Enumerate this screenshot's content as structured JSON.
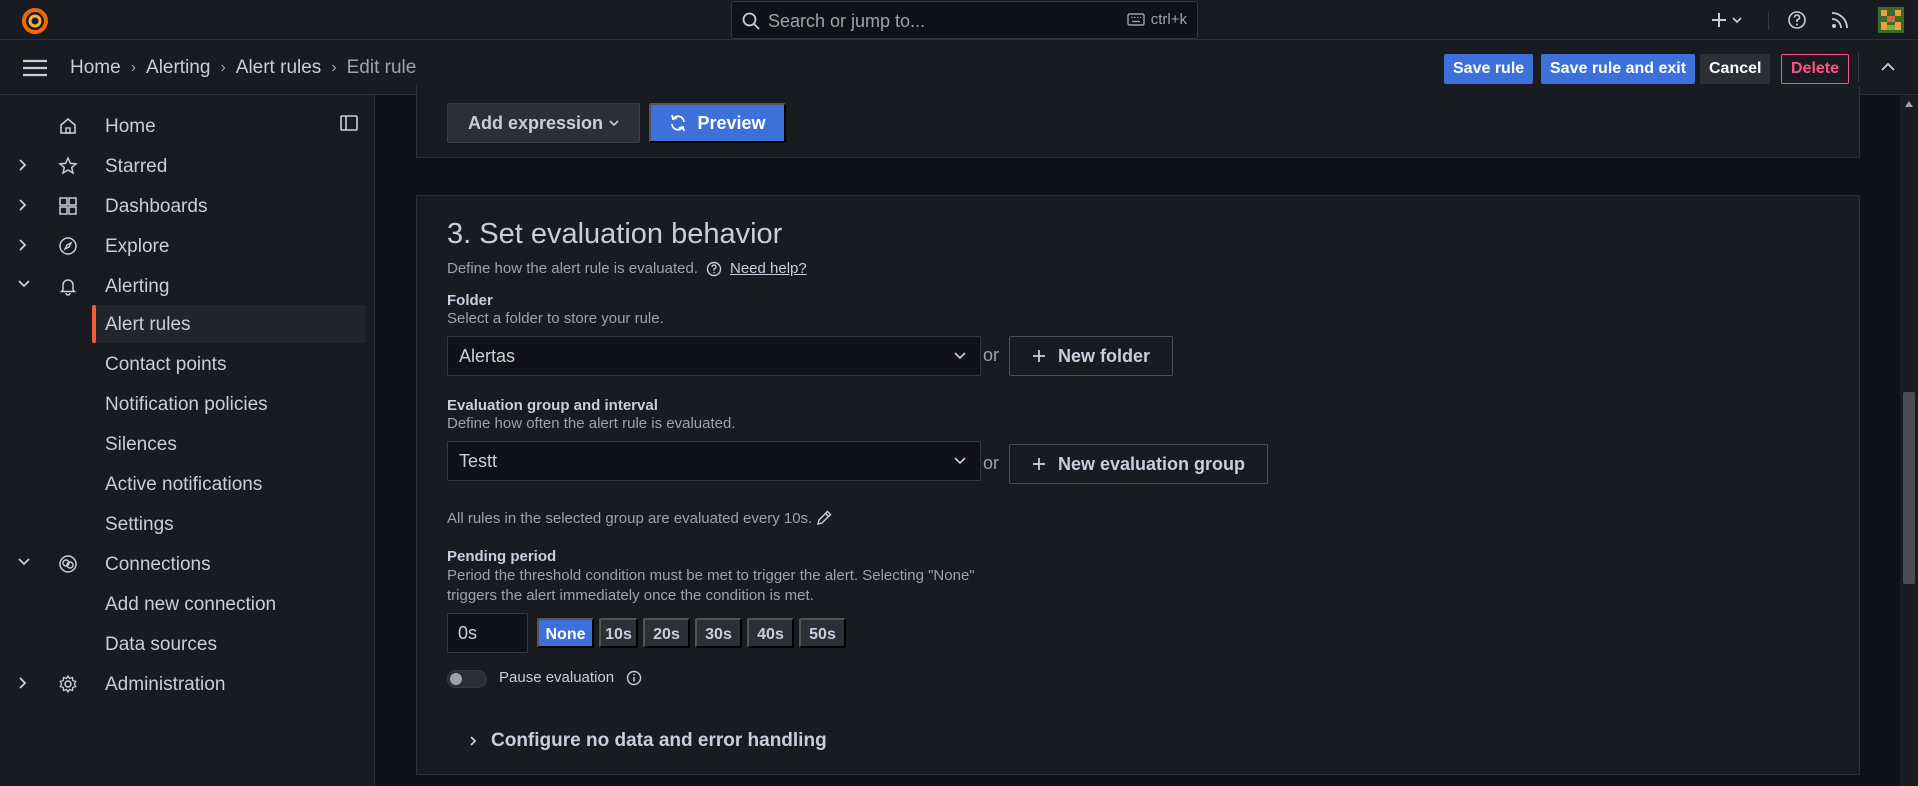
{
  "topbar": {
    "search_placeholder": "Search or jump to...",
    "shortcut": "ctrl+k",
    "icons": [
      "grafana-logo-icon",
      "search-icon",
      "keyboard-icon",
      "plus-icon",
      "chevron-down-icon",
      "help-icon",
      "rss-icon",
      "avatar"
    ]
  },
  "breadcrumb": {
    "items": [
      "Home",
      "Alerting",
      "Alert rules",
      "Edit rule"
    ],
    "separator": "›"
  },
  "actions": {
    "save": "Save rule",
    "save_exit": "Save rule and exit",
    "cancel": "Cancel",
    "delete": "Delete"
  },
  "sidebar": {
    "items": [
      {
        "label": "Home",
        "icon": "home-icon"
      },
      {
        "label": "Starred",
        "icon": "star-icon"
      },
      {
        "label": "Dashboards",
        "icon": "dashboards-icon"
      },
      {
        "label": "Explore",
        "icon": "compass-icon"
      },
      {
        "label": "Alerting",
        "icon": "bell-icon"
      },
      {
        "label": "Connections",
        "icon": "connections-icon"
      },
      {
        "label": "Administration",
        "icon": "gear-icon"
      }
    ],
    "alerting_children": [
      "Alert rules",
      "Contact points",
      "Notification policies",
      "Silences",
      "Active notifications",
      "Settings"
    ],
    "connections_children": [
      "Add new connection",
      "Data sources"
    ]
  },
  "query_section": {
    "add_expression": "Add expression",
    "preview": "Preview"
  },
  "evaluation": {
    "title": "3. Set evaluation behavior",
    "description": "Define how the alert rule is evaluated.",
    "help_link": "Need help?",
    "folder": {
      "label": "Folder",
      "description": "Select a folder to store your rule.",
      "value": "Alertas",
      "or": "or",
      "new_button": "New folder"
    },
    "group": {
      "label": "Evaluation group and interval",
      "description": "Define how often the alert rule is evaluated.",
      "value": "Testt",
      "or": "or",
      "new_button": "New evaluation group"
    },
    "group_info": "All rules in the selected group are evaluated every 10s.",
    "pending": {
      "label": "Pending period",
      "description_line1": "Period the threshold condition must be met to trigger the alert. Selecting \"None\"",
      "description_line2": "triggers the alert immediately once the condition is met.",
      "value": "0s",
      "options": [
        "None",
        "10s",
        "20s",
        "30s",
        "40s",
        "50s"
      ],
      "selected": "None"
    },
    "pause_label": "Pause evaluation",
    "pause_enabled": false,
    "no_data_section": "Configure no data and error handling"
  },
  "colors": {
    "accent": "#3d71d9",
    "danger": "#ff5286",
    "active_indicator": "#f55f3e",
    "background": "#111217",
    "panel": "#181b1f"
  }
}
